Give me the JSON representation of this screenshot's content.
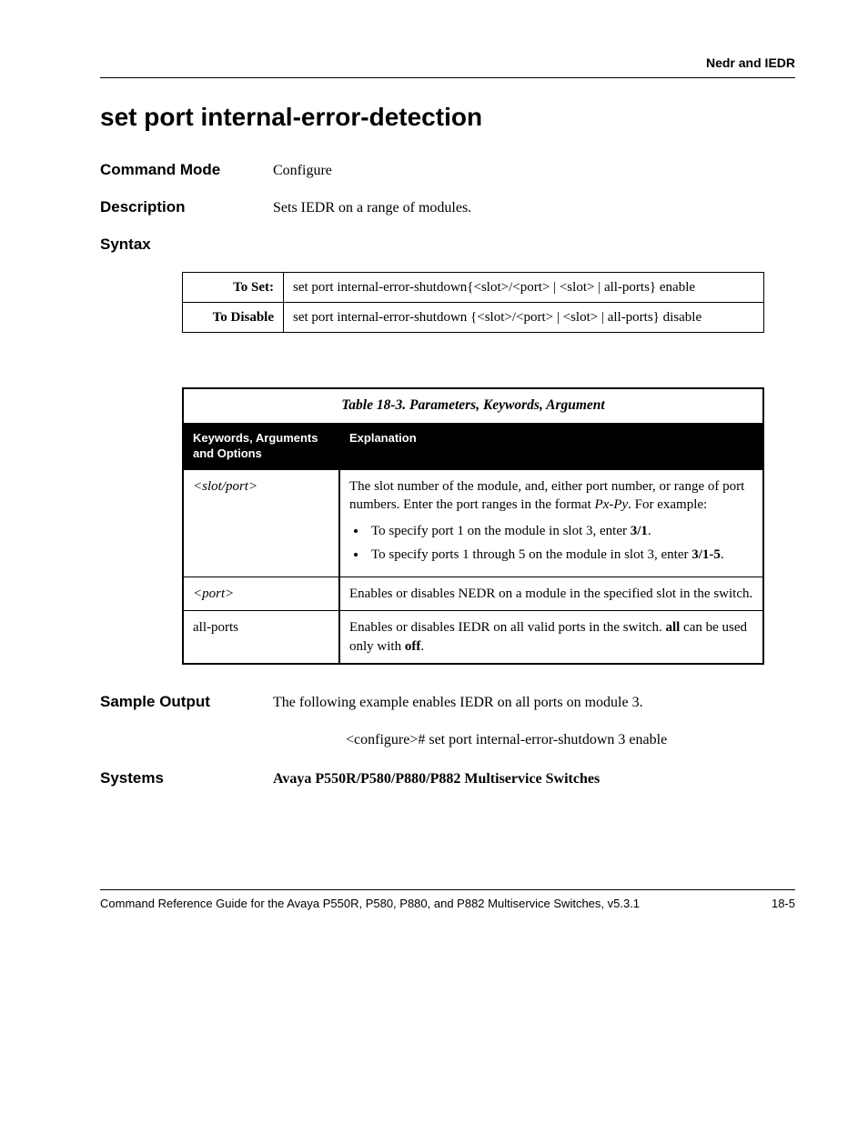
{
  "running_head": "Nedr and IEDR",
  "title": "set port internal-error-detection",
  "sections": {
    "command_mode": {
      "label": "Command Mode",
      "value": "Configure"
    },
    "description": {
      "label": "Description",
      "value": "Sets IEDR on a range of modules."
    },
    "syntax_label": "Syntax",
    "sample_output": {
      "label": "Sample Output",
      "intro": "The following example enables IEDR on all ports on module 3.",
      "code": "<configure># set port internal-error-shutdown 3 enable"
    },
    "systems": {
      "label": "Systems",
      "value": "Avaya P550R/P580/P880/P882 Multiservice Switches"
    }
  },
  "syntax_rows": {
    "set": {
      "label": "To Set:",
      "text": "set port internal-error-shutdown{<slot>/<port> | <slot> | all-ports} enable"
    },
    "disable": {
      "label": "To Disable",
      "text": "set port internal-error-shutdown {<slot>/<port> | <slot> | all-ports} disable"
    }
  },
  "param_table": {
    "caption": "Table 18-3.  Parameters, Keywords, Argument",
    "headers": {
      "kw": "Keywords, Arguments and Options",
      "exp": "Explanation"
    },
    "rows": {
      "r1": {
        "kw": "<slot/port>",
        "intro_pre": "The slot number of the module, and, either port number, or range of port numbers. Enter the port ranges in the format ",
        "intro_fmt": "Px-Py",
        "intro_post": ". For example:",
        "b1_pre": "To specify port 1 on the module in slot 3, enter ",
        "b1_val": "3/1",
        "b1_post": ".",
        "b2_pre": "To specify ports 1 through 5 on the module in slot 3, enter ",
        "b2_val": "3/1-5",
        "b2_post": "."
      },
      "r2": {
        "kw": "<port>",
        "exp": "Enables or disables NEDR on a module in the specified slot in the switch."
      },
      "r3": {
        "kw": "all-ports",
        "pre": "Enables or disables IEDR on all valid ports in the switch. ",
        "all": "all",
        "mid": " can be used only with ",
        "off": "off",
        "post": "."
      }
    }
  },
  "footer": {
    "left": "Command Reference Guide for the Avaya P550R, P580, P880, and P882 Multiservice Switches, v5.3.1",
    "right": "18-5"
  }
}
